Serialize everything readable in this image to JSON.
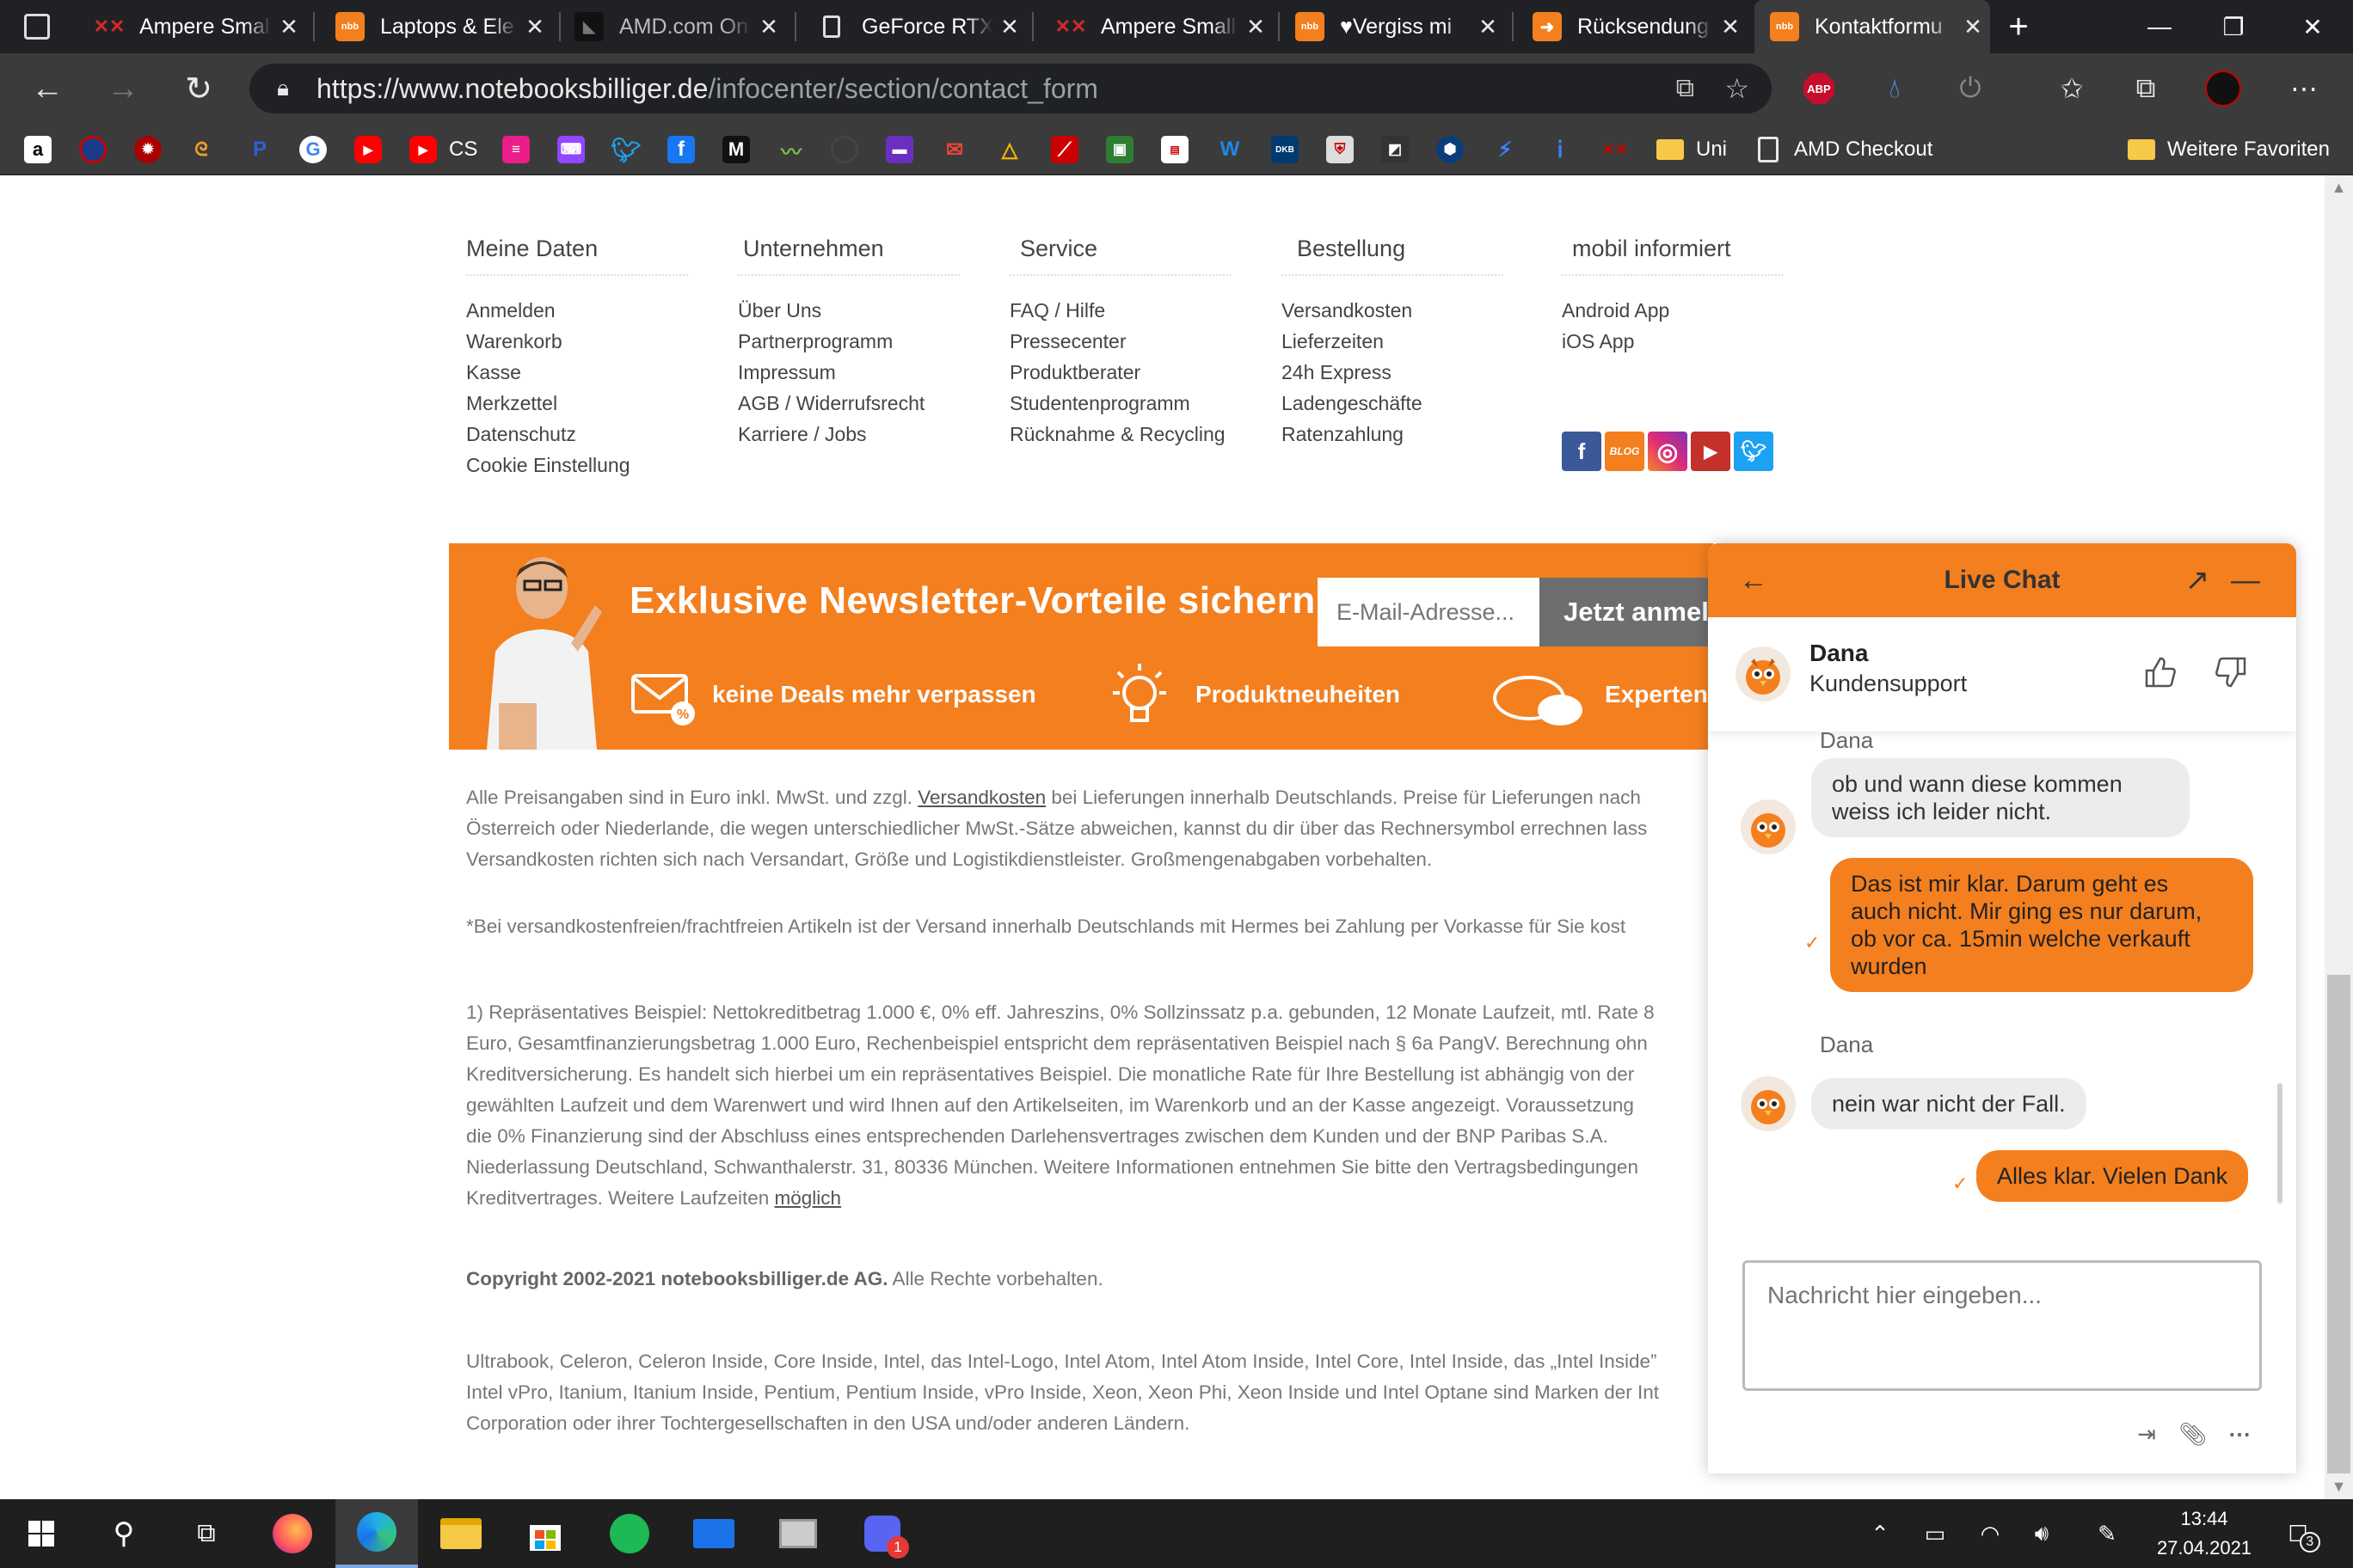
{
  "browser": {
    "tabs": [
      {
        "title": "Ampere Small",
        "icon": "xx-icon"
      },
      {
        "title": "Laptops & Ele",
        "icon": "nbb-icon"
      },
      {
        "title": "AMD.com On",
        "icon": "amd-icon"
      },
      {
        "title": "GeForce RTX",
        "icon": "page-icon"
      },
      {
        "title": "Ampere Small",
        "icon": "xx-icon"
      },
      {
        "title": "♥Vergiss mi",
        "icon": "nbb-icon"
      },
      {
        "title": "Rücksendung",
        "icon": "return-icon"
      },
      {
        "title": "Kontaktformu",
        "icon": "nbb-icon",
        "active": true
      }
    ],
    "url_host": "https://www.notebooksbilliger.de",
    "url_path": "/infocenter/section/contact_form",
    "abp_label": "ABP",
    "bookmark_text": {
      "cs": "CS",
      "uni": "Uni",
      "amd_checkout": "AMD Checkout",
      "more": "Weitere Favoriten"
    }
  },
  "footer": {
    "columns": [
      {
        "title": "Meine Daten",
        "links": [
          "Anmelden",
          "Warenkorb",
          "Kasse",
          "Merkzettel",
          "Datenschutz",
          "Cookie Einstellung"
        ]
      },
      {
        "title": "Unternehmen",
        "links": [
          "Über Uns",
          "Partnerprogramm",
          "Impressum",
          "AGB / Widerrufsrecht",
          "Karriere / Jobs"
        ]
      },
      {
        "title": "Service",
        "links": [
          "FAQ / Hilfe",
          "Pressecenter",
          "Produktberater",
          "Studentenprogramm",
          "Rücknahme & Recycling"
        ]
      },
      {
        "title": "Bestellung",
        "links": [
          "Versandkosten",
          "Lieferzeiten",
          "24h Express",
          "Ladengeschäfte",
          "Ratenzahlung"
        ]
      },
      {
        "title": "mobil informiert",
        "links": [
          "Android App",
          "iOS App"
        ]
      }
    ],
    "social_blog": "BLOG"
  },
  "newsletter": {
    "title": "Exklusive Newsletter-Vorteile sichern",
    "email_placeholder": "E-Mail-Adresse...",
    "button": "Jetzt anmelden",
    "features": [
      "keine Deals mehr verpassen",
      "Produktneuheiten",
      "Expertentipps"
    ]
  },
  "legal": {
    "p1_line1_a": "Alle Preisangaben sind in Euro inkl. MwSt. und zzgl. ",
    "p1_link": "Versandkosten",
    "p1_line1_b": " bei Lieferungen innerhalb Deutschlands. Preise für Lieferungen nach",
    "p1_line2": "Österreich oder Niederlande, die wegen unterschiedlicher MwSt.-Sätze abweichen, kannst du dir über das Rechnersymbol errechnen lass",
    "p1_line3": "Versandkosten richten sich nach Versandart, Größe und Logistikdienstleister. Großmengenabgaben vorbehalten.",
    "p2": "*Bei versandkostenfreien/frachtfreien Artikeln ist der Versand innerhalb Deutschlands mit Hermes bei Zahlung per Vorkasse für Sie kost",
    "p3_lines": [
      "1) Repräsentatives Beispiel: Nettokreditbetrag 1.000 €, 0% eff. Jahreszins, 0% Sollzinssatz p.a. gebunden, 12 Monate Laufzeit, mtl. Rate 8",
      "Euro, Gesamtfinanzierungsbetrag 1.000 Euro, Rechenbeispiel entspricht dem repräsentativen Beispiel nach § 6a PangV. Berechnung ohn",
      "Kreditversicherung. Es handelt sich hierbei um ein repräsentatives Beispiel. Die monatliche Rate für Ihre Bestellung ist abhängig von der",
      "gewählten Laufzeit und dem Warenwert und wird Ihnen auf den Artikelseiten, im Warenkorb und an der Kasse angezeigt. Voraussetzung",
      "die 0% Finanzierung sind der Abschluss eines entsprechenden Darlehensvertrages zwischen dem Kunden und der BNP Paribas S.A.",
      "Niederlassung Deutschland, Schwanthalerstr. 31, 80336 München. Weitere Informationen entnehmen Sie bitte den Vertragsbedingungen"
    ],
    "p3_last_a": "Kreditvertrages. Weitere Laufzeiten ",
    "p3_last_link": "möglich",
    "copyright_bold": "Copyright 2002-2021 notebooksbilliger.de AG.",
    "copyright_rest": " Alle Rechte vorbehalten.",
    "trademarks": [
      "Ultrabook, Celeron, Celeron Inside, Core Inside, Intel, das Intel-Logo, Intel Atom, Intel Atom Inside, Intel Core, Intel Inside, das „Intel Inside”",
      "Intel vPro, Itanium, Itanium Inside, Pentium, Pentium Inside, vPro Inside, Xeon, Xeon Phi, Xeon Inside und Intel Optane sind Marken der Int",
      "Corporation oder ihrer Tochtergesellschaften in den USA und/oder anderen Ländern."
    ]
  },
  "chat": {
    "title": "Live Chat",
    "agent_name": "Dana",
    "agent_role": "Kundensupport",
    "messages": [
      {
        "from": "agent",
        "sender": "Dana",
        "lines": [
          "ob und wann diese kommen",
          "weiss ich leider nicht."
        ]
      },
      {
        "from": "me",
        "lines": [
          "Das ist mir klar. Darum geht es",
          "auch nicht. Mir ging es nur darum,",
          "ob vor ca. 15min welche verkauft",
          "wurden"
        ]
      },
      {
        "from": "agent",
        "sender": "Dana",
        "lines": [
          "nein war nicht der Fall."
        ]
      },
      {
        "from": "me",
        "lines": [
          "Alles klar. Vielen Dank"
        ]
      }
    ],
    "input_placeholder": "Nachricht hier eingeben..."
  },
  "taskbar": {
    "time": "13:44",
    "date": "27.04.2021",
    "notification_count": "3",
    "discord_badge": "1"
  },
  "colors": {
    "brand_orange": "#f47f1f",
    "tabbar": "#202124",
    "toolbar": "#3b3b3b"
  }
}
